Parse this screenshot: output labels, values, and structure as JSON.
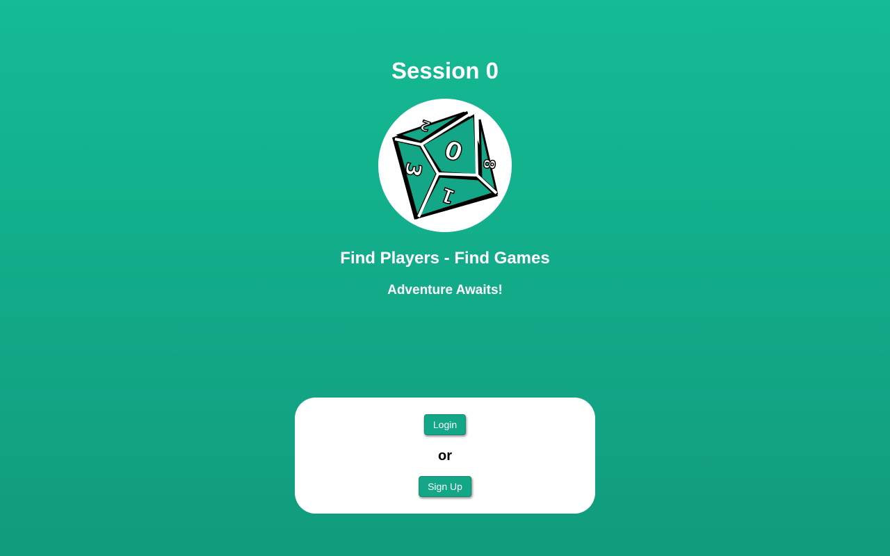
{
  "page": {
    "title": "Session 0",
    "tagline": "Find Players - Find Games",
    "subtagline": "Adventure Awaits!"
  },
  "logo": {
    "icon": "d10-dice-icon",
    "face_numbers": [
      "0",
      "3",
      "8",
      "1",
      "2"
    ]
  },
  "auth": {
    "login_label": "Login",
    "or_label": "or",
    "signup_label": "Sign Up"
  },
  "colors": {
    "background_top": "#14bb95",
    "background_bottom": "#119b7d",
    "button": "#14a787",
    "dice_face": "#14a787",
    "card": "#ffffff"
  }
}
